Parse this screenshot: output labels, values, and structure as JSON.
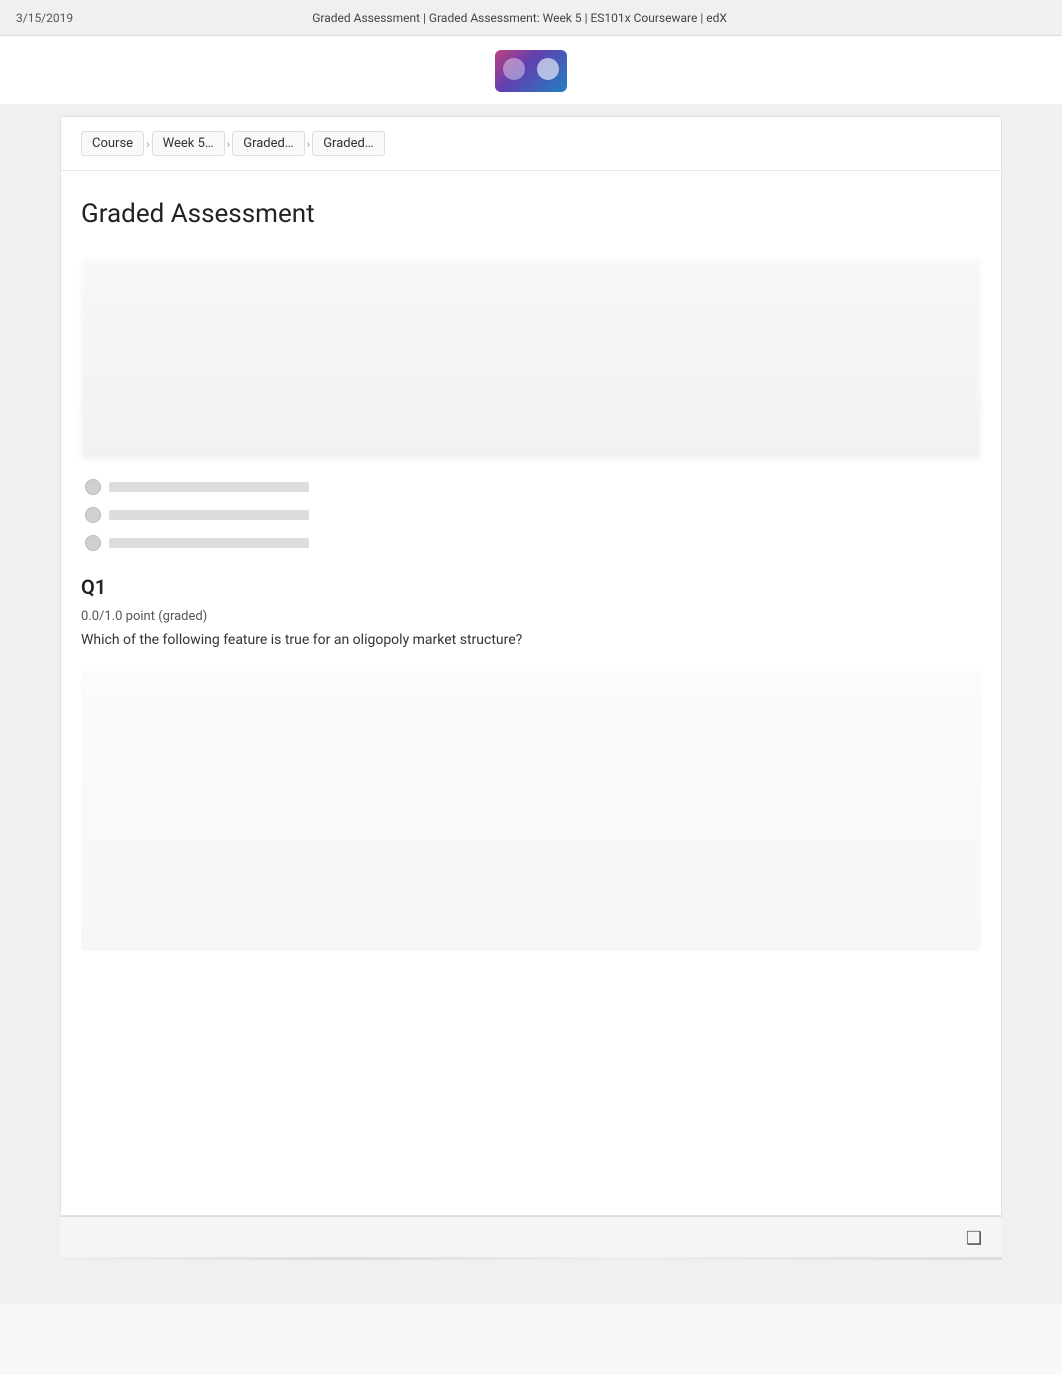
{
  "browser": {
    "date": "3/15/2019",
    "title": "Graded Assessment | Graded Assessment: Week 5 | ES101x Courseware | edX"
  },
  "breadcrumb": {
    "items": [
      {
        "label": "Course"
      },
      {
        "label": "Week 5…"
      },
      {
        "label": "Graded…"
      },
      {
        "label": "Graded…"
      }
    ]
  },
  "page": {
    "heading": "Graded Assessment"
  },
  "question": {
    "id": "Q1",
    "meta": "0.0/1.0 point (graded)",
    "text": "Which of the following feature is true for an oligopoly market structure?"
  },
  "bottom_icon": "❑"
}
